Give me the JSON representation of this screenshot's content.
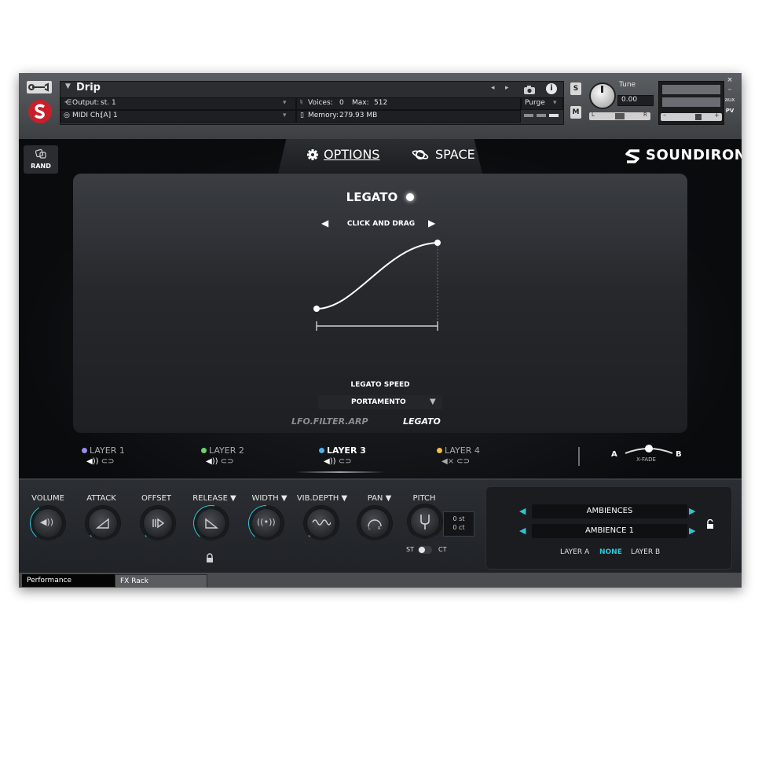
{
  "header": {
    "instrument_name": "Drip",
    "output_label": "Output:",
    "output_value": "st. 1",
    "midi_label": "MIDI Ch:",
    "midi_value": "[A]  1",
    "voices_label": "Voices:",
    "voices_value": "0",
    "max_label": "Max:",
    "max_value": "512",
    "memory_label": "Memory:",
    "memory_value": "279.93 MB",
    "purge_label": "Purge",
    "solo_label": "S",
    "mute_label": "M",
    "tune_label": "Tune",
    "tune_value": "0.00",
    "pan_l": "L",
    "pan_r": "R",
    "aux_label": "aux",
    "pv_label": "PV",
    "minus": "–",
    "plus": "+"
  },
  "main": {
    "rand_label": "RAND",
    "tabs": [
      {
        "label": "OPTIONS"
      },
      {
        "label": "SPACE"
      }
    ],
    "brand": "SOUNDIRON",
    "legato_title": "LEGATO",
    "curve_hint": "CLICK AND DRAG",
    "legato_speed_label": "LEGATO SPEED",
    "portamento_value": "PORTAMENTO",
    "sub_left": "LFO.FILTER.ARP",
    "sub_right": "LEGATO"
  },
  "layers": [
    {
      "label": "LAYER 1",
      "color": "#9b8cf0",
      "speaker": "◀))",
      "active": false
    },
    {
      "label": "LAYER 2",
      "color": "#6fd36a",
      "speaker": "◀))",
      "active": false
    },
    {
      "label": "LAYER 3",
      "color": "#4fb0e8",
      "speaker": "◀))",
      "active": true
    },
    {
      "label": "LAYER 4",
      "color": "#f0c04a",
      "speaker": "◀×",
      "active": false
    }
  ],
  "xfade": {
    "a": "A",
    "b": "B",
    "label": "X-FADE"
  },
  "controls": {
    "knobs": [
      "VOLUME",
      "ATTACK",
      "OFFSET",
      "RELEASE ▼",
      "WIDTH ▼",
      "VIB.DEPTH ▼",
      "PAN ▼",
      "PITCH"
    ],
    "pitch_st": "0 st",
    "pitch_ct": "0 ct",
    "st_label": "ST",
    "ct_label": "CT"
  },
  "ambience": {
    "category": "AMBIENCES",
    "preset": "AMBIENCE 1",
    "layer_a": "LAYER A",
    "none": "NONE",
    "layer_b": "LAYER B"
  },
  "bottom_tabs": [
    {
      "label": "Performance"
    },
    {
      "label": "FX Rack"
    }
  ],
  "colors": {
    "accent": "#2ec4d8",
    "logo_red": "#c8202a"
  }
}
